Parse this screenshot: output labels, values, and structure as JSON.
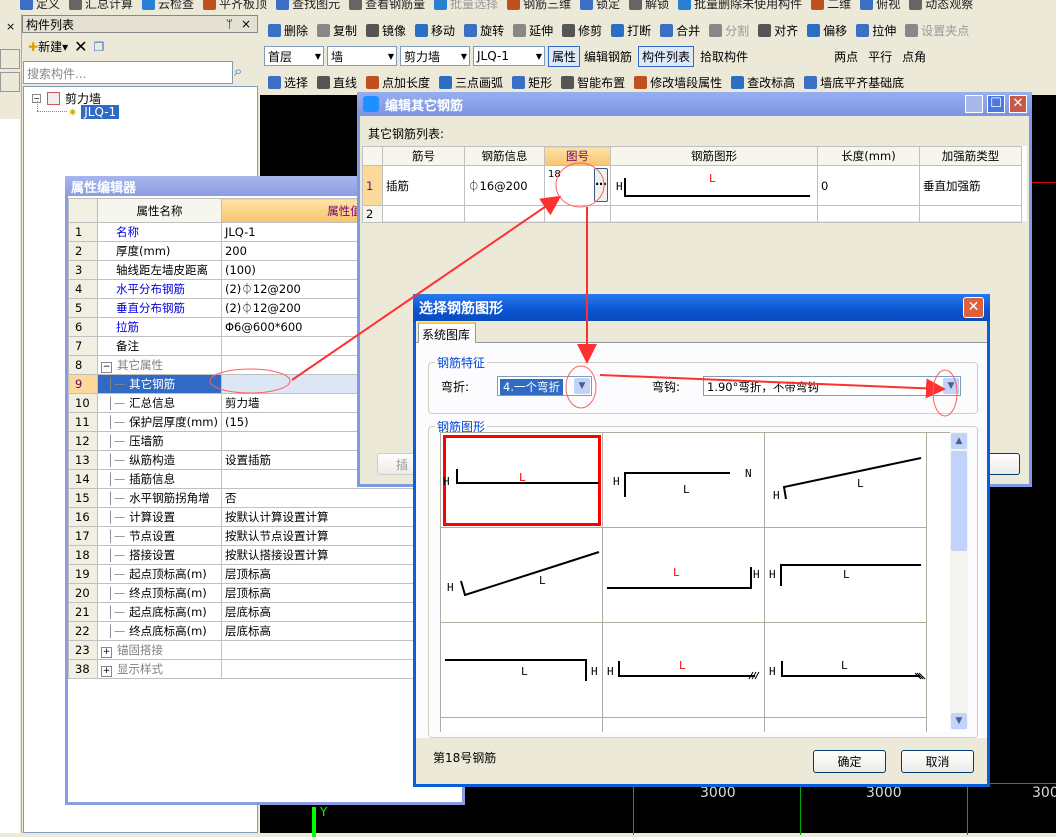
{
  "top_toolbar": [
    "定义",
    "汇总计算",
    "云检查",
    "平齐板顶",
    "查找图元",
    "查看钢筋量",
    "批量选择",
    "钢筋三维",
    "锁定",
    "解锁",
    "批量删除未使用构件",
    "二维",
    "俯视",
    "动态观察"
  ],
  "component_panel": {
    "title": "构件列表",
    "new_label": "新建",
    "search_placeholder": "搜索构件...",
    "tree": {
      "root": "剪力墙",
      "child": "JLQ-1"
    }
  },
  "edit_toolbar": [
    "删除",
    "复制",
    "镜像",
    "移动",
    "旋转",
    "延伸",
    "修剪",
    "打断",
    "合并",
    "分割",
    "对齐",
    "偏移",
    "拉伸",
    "设置夹点"
  ],
  "selector_toolbar": {
    "floor": "首层",
    "type": "墙",
    "subtype": "剪力墙",
    "component": "JLQ-1",
    "buttons": [
      "属性",
      "编辑钢筋",
      "构件列表",
      "拾取构件"
    ],
    "right": [
      "两点",
      "平行",
      "点角"
    ]
  },
  "draw_toolbar": [
    "选择",
    "直线",
    "点加长度",
    "三点画弧",
    "矩形",
    "智能布置",
    "修改墙段属性",
    "查改标高",
    "墙底平齐基础底"
  ],
  "property_editor": {
    "title": "属性编辑器",
    "headers": [
      "属性名称",
      "属性值"
    ],
    "rows": [
      {
        "n": "1",
        "k": "名称",
        "v": "JLQ-1",
        "style": "blue"
      },
      {
        "n": "2",
        "k": "厚度(mm)",
        "v": "200"
      },
      {
        "n": "3",
        "k": "轴线距左墙皮距离",
        "v": "(100)"
      },
      {
        "n": "4",
        "k": "水平分布钢筋",
        "v": "(2)⏀12@200",
        "style": "blue"
      },
      {
        "n": "5",
        "k": "垂直分布钢筋",
        "v": "(2)⏀12@200",
        "style": "blue"
      },
      {
        "n": "6",
        "k": "拉筋",
        "v": "Φ6@600*600",
        "style": "blue"
      },
      {
        "n": "7",
        "k": "备注",
        "v": ""
      },
      {
        "n": "8",
        "k": "其它属性",
        "v": "",
        "style": "group-open"
      },
      {
        "n": "9",
        "k": "其它钢筋",
        "v": "",
        "style": "child selected"
      },
      {
        "n": "10",
        "k": "汇总信息",
        "v": "剪力墙",
        "style": "child"
      },
      {
        "n": "11",
        "k": "保护层厚度(mm)",
        "v": "(15)",
        "style": "child"
      },
      {
        "n": "12",
        "k": "压墙筋",
        "v": "",
        "style": "child"
      },
      {
        "n": "13",
        "k": "纵筋构造",
        "v": "设置插筋",
        "style": "child"
      },
      {
        "n": "14",
        "k": "插筋信息",
        "v": "",
        "style": "child"
      },
      {
        "n": "15",
        "k": "水平钢筋拐角增",
        "v": "否",
        "style": "child"
      },
      {
        "n": "16",
        "k": "计算设置",
        "v": "按默认计算设置计算",
        "style": "child"
      },
      {
        "n": "17",
        "k": "节点设置",
        "v": "按默认节点设置计算",
        "style": "child"
      },
      {
        "n": "18",
        "k": "搭接设置",
        "v": "按默认搭接设置计算",
        "style": "child"
      },
      {
        "n": "19",
        "k": "起点顶标高(m)",
        "v": "层顶标高",
        "style": "child"
      },
      {
        "n": "20",
        "k": "终点顶标高(m)",
        "v": "层顶标高",
        "style": "child"
      },
      {
        "n": "21",
        "k": "起点底标高(m)",
        "v": "层底标高",
        "style": "child"
      },
      {
        "n": "22",
        "k": "终点底标高(m)",
        "v": "层底标高",
        "style": "child"
      },
      {
        "n": "23",
        "k": "锚固搭接",
        "v": "",
        "style": "group-closed"
      },
      {
        "n": "38",
        "k": "显示样式",
        "v": "",
        "style": "group-closed"
      }
    ]
  },
  "edit_rebar_dialog": {
    "title": "编辑其它钢筋",
    "list_label": "其它钢筋列表:",
    "headers": [
      "筋号",
      "钢筋信息",
      "图号",
      "钢筋图形",
      "长度(mm)",
      "加强筋类型"
    ],
    "rows": [
      {
        "n": "1",
        "name": "插筋",
        "info": "⏀16@200",
        "fig": "18",
        "len": "0",
        "type": "垂直加强筋"
      },
      {
        "n": "2",
        "name": "",
        "info": "",
        "fig": "",
        "len": "",
        "type": ""
      }
    ],
    "insert_btn": "插"
  },
  "select_shape_dialog": {
    "title": "选择钢筋图形",
    "tab": "系统图库",
    "feature_group": "钢筋特征",
    "bend_label": "弯折:",
    "bend_value": "4.一个弯折",
    "hook_label": "弯钩:",
    "hook_value": "1.90°弯折，不带弯钩",
    "shape_group": "钢筋图形",
    "status": "第18号钢筋",
    "ok": "确定",
    "cancel": "取消"
  },
  "canvas": {
    "dims": [
      "3000",
      "3000",
      "3000"
    ],
    "axis": "Y"
  },
  "colors": {
    "accent_red": "#ff0000",
    "title_blue": "#0a5fd8",
    "selection": "#316ac5"
  }
}
